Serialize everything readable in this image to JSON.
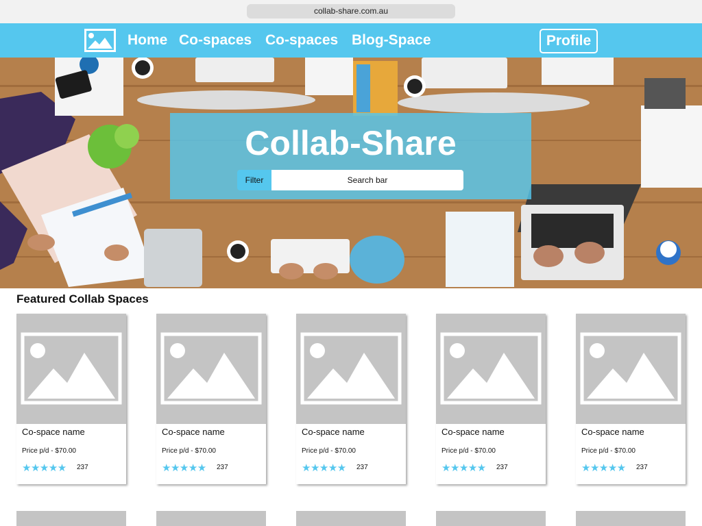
{
  "browser": {
    "url": "collab-share.com.au"
  },
  "nav": {
    "logo_icon": "image-placeholder-icon",
    "links": [
      "Home",
      "Co-spaces",
      "Co-spaces",
      "Blog-Space"
    ],
    "profile_label": "Profile",
    "color": "#55c7ee"
  },
  "hero": {
    "title": "Collab-Share",
    "filter_label": "Filter",
    "search_placeholder": "Search bar"
  },
  "featured": {
    "title": "Featured Collab Spaces",
    "cards": [
      {
        "name": "Co-space name",
        "price": "Price p/d - $70.00",
        "stars": "★★★★★",
        "rating_count": "237"
      },
      {
        "name": "Co-space name",
        "price": "Price p/d - $70.00",
        "stars": "★★★★★",
        "rating_count": "237"
      },
      {
        "name": "Co-space name",
        "price": "Price p/d - $70.00",
        "stars": "★★★★★",
        "rating_count": "237"
      },
      {
        "name": "Co-space name",
        "price": "Price p/d - $70.00",
        "stars": "★★★★★",
        "rating_count": "237"
      },
      {
        "name": "Co-space name",
        "price": "Price p/d - $70.00",
        "stars": "★★★★★",
        "rating_count": "237"
      }
    ]
  }
}
